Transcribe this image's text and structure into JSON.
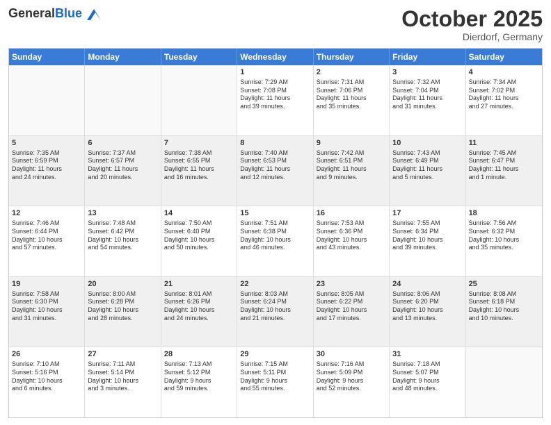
{
  "header": {
    "logo_general": "General",
    "logo_blue": "Blue",
    "month_title": "October 2025",
    "location": "Dierdorf, Germany"
  },
  "weekdays": [
    "Sunday",
    "Monday",
    "Tuesday",
    "Wednesday",
    "Thursday",
    "Friday",
    "Saturday"
  ],
  "rows": [
    [
      {
        "day": "",
        "info": "",
        "empty": true
      },
      {
        "day": "",
        "info": "",
        "empty": true
      },
      {
        "day": "",
        "info": "",
        "empty": true
      },
      {
        "day": "1",
        "info": "Sunrise: 7:29 AM\nSunset: 7:08 PM\nDaylight: 11 hours\nand 39 minutes."
      },
      {
        "day": "2",
        "info": "Sunrise: 7:31 AM\nSunset: 7:06 PM\nDaylight: 11 hours\nand 35 minutes."
      },
      {
        "day": "3",
        "info": "Sunrise: 7:32 AM\nSunset: 7:04 PM\nDaylight: 11 hours\nand 31 minutes."
      },
      {
        "day": "4",
        "info": "Sunrise: 7:34 AM\nSunset: 7:02 PM\nDaylight: 11 hours\nand 27 minutes."
      }
    ],
    [
      {
        "day": "5",
        "info": "Sunrise: 7:35 AM\nSunset: 6:59 PM\nDaylight: 11 hours\nand 24 minutes."
      },
      {
        "day": "6",
        "info": "Sunrise: 7:37 AM\nSunset: 6:57 PM\nDaylight: 11 hours\nand 20 minutes."
      },
      {
        "day": "7",
        "info": "Sunrise: 7:38 AM\nSunset: 6:55 PM\nDaylight: 11 hours\nand 16 minutes."
      },
      {
        "day": "8",
        "info": "Sunrise: 7:40 AM\nSunset: 6:53 PM\nDaylight: 11 hours\nand 12 minutes."
      },
      {
        "day": "9",
        "info": "Sunrise: 7:42 AM\nSunset: 6:51 PM\nDaylight: 11 hours\nand 9 minutes."
      },
      {
        "day": "10",
        "info": "Sunrise: 7:43 AM\nSunset: 6:49 PM\nDaylight: 11 hours\nand 5 minutes."
      },
      {
        "day": "11",
        "info": "Sunrise: 7:45 AM\nSunset: 6:47 PM\nDaylight: 11 hours\nand 1 minute."
      }
    ],
    [
      {
        "day": "12",
        "info": "Sunrise: 7:46 AM\nSunset: 6:44 PM\nDaylight: 10 hours\nand 57 minutes."
      },
      {
        "day": "13",
        "info": "Sunrise: 7:48 AM\nSunset: 6:42 PM\nDaylight: 10 hours\nand 54 minutes."
      },
      {
        "day": "14",
        "info": "Sunrise: 7:50 AM\nSunset: 6:40 PM\nDaylight: 10 hours\nand 50 minutes."
      },
      {
        "day": "15",
        "info": "Sunrise: 7:51 AM\nSunset: 6:38 PM\nDaylight: 10 hours\nand 46 minutes."
      },
      {
        "day": "16",
        "info": "Sunrise: 7:53 AM\nSunset: 6:36 PM\nDaylight: 10 hours\nand 43 minutes."
      },
      {
        "day": "17",
        "info": "Sunrise: 7:55 AM\nSunset: 6:34 PM\nDaylight: 10 hours\nand 39 minutes."
      },
      {
        "day": "18",
        "info": "Sunrise: 7:56 AM\nSunset: 6:32 PM\nDaylight: 10 hours\nand 35 minutes."
      }
    ],
    [
      {
        "day": "19",
        "info": "Sunrise: 7:58 AM\nSunset: 6:30 PM\nDaylight: 10 hours\nand 31 minutes."
      },
      {
        "day": "20",
        "info": "Sunrise: 8:00 AM\nSunset: 6:28 PM\nDaylight: 10 hours\nand 28 minutes."
      },
      {
        "day": "21",
        "info": "Sunrise: 8:01 AM\nSunset: 6:26 PM\nDaylight: 10 hours\nand 24 minutes."
      },
      {
        "day": "22",
        "info": "Sunrise: 8:03 AM\nSunset: 6:24 PM\nDaylight: 10 hours\nand 21 minutes."
      },
      {
        "day": "23",
        "info": "Sunrise: 8:05 AM\nSunset: 6:22 PM\nDaylight: 10 hours\nand 17 minutes."
      },
      {
        "day": "24",
        "info": "Sunrise: 8:06 AM\nSunset: 6:20 PM\nDaylight: 10 hours\nand 13 minutes."
      },
      {
        "day": "25",
        "info": "Sunrise: 8:08 AM\nSunset: 6:18 PM\nDaylight: 10 hours\nand 10 minutes."
      }
    ],
    [
      {
        "day": "26",
        "info": "Sunrise: 7:10 AM\nSunset: 5:16 PM\nDaylight: 10 hours\nand 6 minutes."
      },
      {
        "day": "27",
        "info": "Sunrise: 7:11 AM\nSunset: 5:14 PM\nDaylight: 10 hours\nand 3 minutes."
      },
      {
        "day": "28",
        "info": "Sunrise: 7:13 AM\nSunset: 5:12 PM\nDaylight: 9 hours\nand 59 minutes."
      },
      {
        "day": "29",
        "info": "Sunrise: 7:15 AM\nSunset: 5:11 PM\nDaylight: 9 hours\nand 55 minutes."
      },
      {
        "day": "30",
        "info": "Sunrise: 7:16 AM\nSunset: 5:09 PM\nDaylight: 9 hours\nand 52 minutes."
      },
      {
        "day": "31",
        "info": "Sunrise: 7:18 AM\nSunset: 5:07 PM\nDaylight: 9 hours\nand 48 minutes."
      },
      {
        "day": "",
        "info": "",
        "empty": true
      }
    ]
  ]
}
